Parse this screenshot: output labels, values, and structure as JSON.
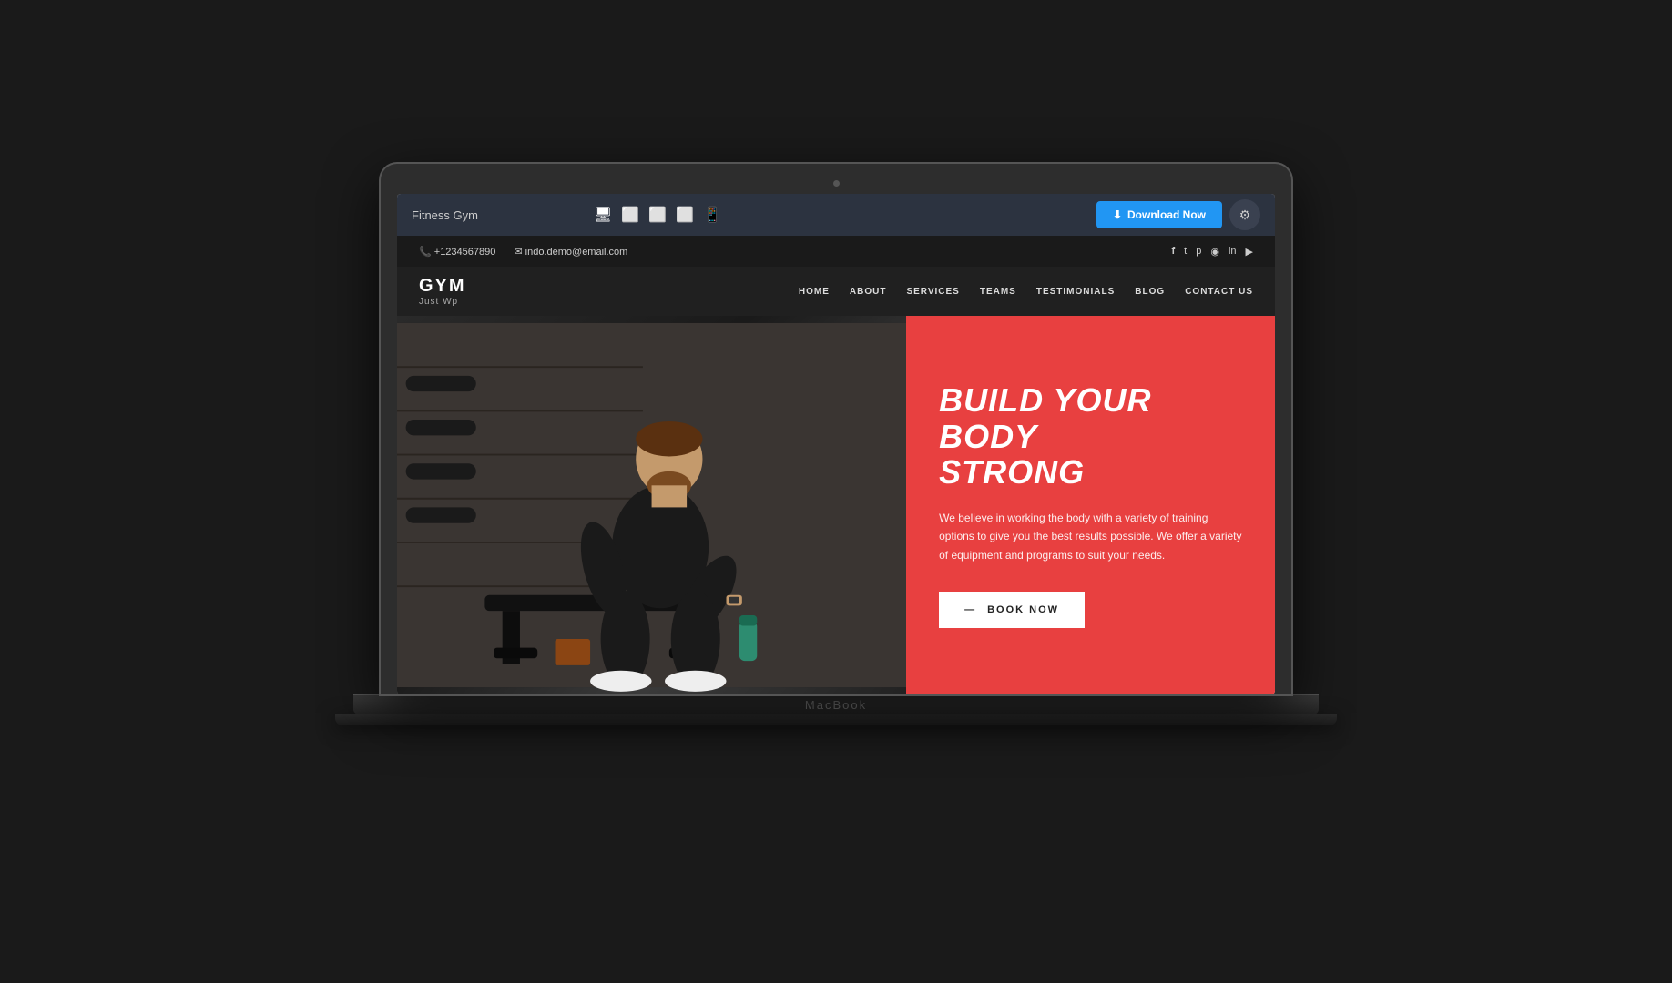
{
  "builder": {
    "site_name": "Fitness Gym",
    "download_label": "Download Now",
    "download_icon": "⬇",
    "settings_icon": "⚙",
    "devices": [
      "🖥",
      "⬜",
      "⬜",
      "⬜",
      "📱"
    ]
  },
  "contact_bar": {
    "phone": "+1234567890",
    "email": "indo.demo@email.com",
    "phone_icon": "📞",
    "email_icon": "✉",
    "socials": [
      "f",
      "𝕥",
      "𝕡",
      "📷",
      "in",
      "▶"
    ]
  },
  "navbar": {
    "logo_title": "GYM",
    "logo_sub": "Just Wp",
    "links": [
      "HOME",
      "ABOUT",
      "SERVICES",
      "TEAMS",
      "TESTIMONIALS",
      "BLOG",
      "CONTACT US"
    ]
  },
  "hero": {
    "title_line1": "BUILD YOUR BODY",
    "title_line2": "STRONG",
    "description": "We believe in working the body with a variety of training options to give you the best results possible. We offer a variety of equipment and programs to suit your needs.",
    "cta_label": "BOOK NOW"
  },
  "macbook": {
    "base_label": "MacBook"
  },
  "colors": {
    "accent_red": "#e84040",
    "dark_maroon": "#7a1a1a",
    "builder_bg": "#2c3340",
    "contact_bg": "#1a1a1a",
    "nav_bg": "#111111",
    "download_btn": "#2196F3"
  }
}
